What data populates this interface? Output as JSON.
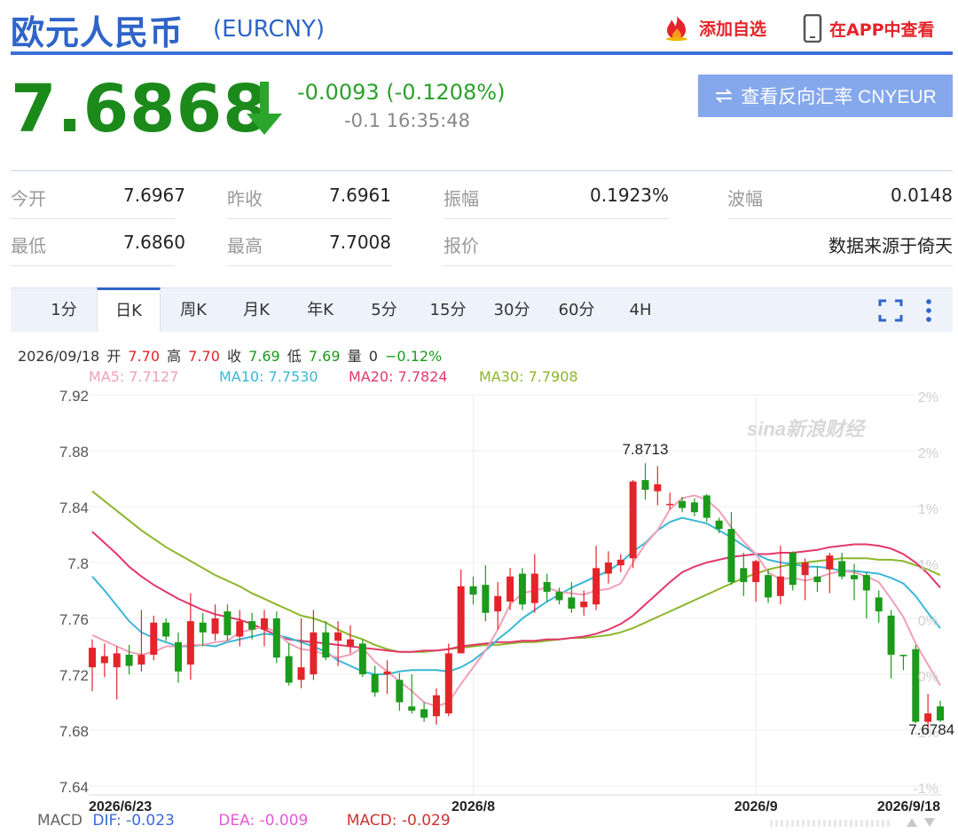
{
  "header": {
    "title": "欧元人民币",
    "code": "(EURCNY)",
    "add_watch": "添加自选",
    "app_view": "在APP中查看"
  },
  "quote": {
    "price": "7.6868",
    "change": "-0.0093 (-0.1208%)",
    "sub": "-0.1 16:35:48",
    "reverse_button": "查看反向汇率 CNYEUR",
    "direction": "down",
    "down_color": "#1b8a1b"
  },
  "stats": [
    {
      "label": "今开",
      "value": "7.6967"
    },
    {
      "label": "昨收",
      "value": "7.6961"
    },
    {
      "label": "振幅",
      "value": "0.1923%"
    },
    {
      "label": "波幅",
      "value": "0.0148"
    },
    {
      "label": "最低",
      "value": "7.6860"
    },
    {
      "label": "最高",
      "value": "7.7008"
    },
    {
      "label": "报价",
      "value": ""
    },
    {
      "label": "",
      "value": "数据来源于倚天"
    }
  ],
  "tabs": [
    "1分",
    "日K",
    "周K",
    "月K",
    "年K",
    "5分",
    "15分",
    "30分",
    "60分",
    "4H"
  ],
  "active_tab": "日K",
  "info": {
    "date": "2026/09/18",
    "open_label": "开",
    "open": "7.70",
    "high_label": "高",
    "high": "7.70",
    "close_label": "收",
    "close": "7.69",
    "low_label": "低",
    "low": "7.69",
    "vol_label": "量",
    "vol": "0",
    "pct": "−0.12%"
  },
  "ma": {
    "ma5": "MA5: 7.7127",
    "ma10": "MA10: 7.7530",
    "ma20": "MA20: 7.7824",
    "ma30": "MA30: 7.7908"
  },
  "macd": {
    "label": "MACD",
    "dif": "DIF: -0.023",
    "dea": "DEA: -0.009",
    "macd": "MACD: -0.029"
  },
  "watermark": "sina新浪财经",
  "chart_data": {
    "type": "candlestick",
    "y_ticks": [
      "7.92",
      "7.88",
      "7.84",
      "7.8",
      "7.76",
      "7.72",
      "7.68",
      "7.64"
    ],
    "ylim": [
      7.64,
      7.92
    ],
    "pct_ticks": [
      "2%",
      "2%",
      "1%",
      "1%",
      "0%",
      "0%",
      "-1%",
      "-1%"
    ],
    "x_ticks": [
      "2026/6/23",
      "2026/8",
      "2026/9",
      "2026/9/18"
    ],
    "x_tick_positions": [
      0,
      31,
      54,
      68
    ],
    "high_label": "7.8713",
    "low_label": "7.6784",
    "colors": {
      "up": "#e4242a",
      "down": "#1b9a1b",
      "ma5": "#f0a0b8",
      "ma10": "#3ab7d6",
      "ma20": "#e3386a",
      "ma30": "#8cb62b"
    },
    "candles": [
      {
        "o": 7.725,
        "c": 7.739,
        "h": 7.745,
        "l": 7.708
      },
      {
        "o": 7.728,
        "c": 7.733,
        "h": 7.742,
        "l": 7.718
      },
      {
        "o": 7.725,
        "c": 7.735,
        "h": 7.74,
        "l": 7.702
      },
      {
        "o": 7.734,
        "c": 7.726,
        "h": 7.741,
        "l": 7.72
      },
      {
        "o": 7.727,
        "c": 7.734,
        "h": 7.766,
        "l": 7.722
      },
      {
        "o": 7.734,
        "c": 7.757,
        "h": 7.762,
        "l": 7.73
      },
      {
        "o": 7.757,
        "c": 7.747,
        "h": 7.76,
        "l": 7.744
      },
      {
        "o": 7.743,
        "c": 7.722,
        "h": 7.75,
        "l": 7.714
      },
      {
        "o": 7.727,
        "c": 7.758,
        "h": 7.778,
        "l": 7.716
      },
      {
        "o": 7.757,
        "c": 7.75,
        "h": 7.764,
        "l": 7.74
      },
      {
        "o": 7.749,
        "c": 7.76,
        "h": 7.77,
        "l": 7.744
      },
      {
        "o": 7.765,
        "c": 7.748,
        "h": 7.77,
        "l": 7.744
      },
      {
        "o": 7.747,
        "c": 7.758,
        "h": 7.766,
        "l": 7.74
      },
      {
        "o": 7.758,
        "c": 7.752,
        "h": 7.764,
        "l": 7.745
      },
      {
        "o": 7.752,
        "c": 7.76,
        "h": 7.766,
        "l": 7.74
      },
      {
        "o": 7.76,
        "c": 7.732,
        "h": 7.765,
        "l": 7.728
      },
      {
        "o": 7.733,
        "c": 7.714,
        "h": 7.742,
        "l": 7.712
      },
      {
        "o": 7.716,
        "c": 7.725,
        "h": 7.76,
        "l": 7.71
      },
      {
        "o": 7.72,
        "c": 7.75,
        "h": 7.766,
        "l": 7.716
      },
      {
        "o": 7.75,
        "c": 7.732,
        "h": 7.758,
        "l": 7.73
      },
      {
        "o": 7.744,
        "c": 7.75,
        "h": 7.758,
        "l": 7.726
      },
      {
        "o": 7.74,
        "c": 7.745,
        "h": 7.755,
        "l": 7.735
      },
      {
        "o": 7.742,
        "c": 7.72,
        "h": 7.745,
        "l": 7.718
      },
      {
        "o": 7.72,
        "c": 7.707,
        "h": 7.726,
        "l": 7.704
      },
      {
        "o": 7.72,
        "c": 7.722,
        "h": 7.73,
        "l": 7.706
      },
      {
        "o": 7.716,
        "c": 7.7,
        "h": 7.721,
        "l": 7.694
      },
      {
        "o": 7.697,
        "c": 7.694,
        "h": 7.72,
        "l": 7.692
      },
      {
        "o": 7.695,
        "c": 7.689,
        "h": 7.7,
        "l": 7.686
      },
      {
        "o": 7.69,
        "c": 7.705,
        "h": 7.71,
        "l": 7.684
      },
      {
        "o": 7.692,
        "c": 7.735,
        "h": 7.742,
        "l": 7.69
      },
      {
        "o": 7.735,
        "c": 7.783,
        "h": 7.795,
        "l": 7.735
      },
      {
        "o": 7.783,
        "c": 7.777,
        "h": 7.79,
        "l": 7.77
      },
      {
        "o": 7.784,
        "c": 7.764,
        "h": 7.798,
        "l": 7.758
      },
      {
        "o": 7.765,
        "c": 7.776,
        "h": 7.786,
        "l": 7.752
      },
      {
        "o": 7.772,
        "c": 7.79,
        "h": 7.796,
        "l": 7.766
      },
      {
        "o": 7.792,
        "c": 7.77,
        "h": 7.796,
        "l": 7.766
      },
      {
        "o": 7.771,
        "c": 7.792,
        "h": 7.806,
        "l": 7.764
      },
      {
        "o": 7.786,
        "c": 7.779,
        "h": 7.792,
        "l": 7.772
      },
      {
        "o": 7.779,
        "c": 7.773,
        "h": 7.782,
        "l": 7.77
      },
      {
        "o": 7.775,
        "c": 7.767,
        "h": 7.786,
        "l": 7.764
      },
      {
        "o": 7.768,
        "c": 7.772,
        "h": 7.78,
        "l": 7.762
      },
      {
        "o": 7.77,
        "c": 7.796,
        "h": 7.812,
        "l": 7.766
      },
      {
        "o": 7.792,
        "c": 7.8,
        "h": 7.808,
        "l": 7.785
      },
      {
        "o": 7.798,
        "c": 7.802,
        "h": 7.806,
        "l": 7.793
      },
      {
        "o": 7.803,
        "c": 7.858,
        "h": 7.859,
        "l": 7.796
      },
      {
        "o": 7.859,
        "c": 7.852,
        "h": 7.871,
        "l": 7.845
      },
      {
        "o": 7.851,
        "c": 7.856,
        "h": 7.869,
        "l": 7.841
      },
      {
        "o": 7.842,
        "c": 7.842,
        "h": 7.85,
        "l": 7.838
      },
      {
        "o": 7.844,
        "c": 7.839,
        "h": 7.847,
        "l": 7.836
      },
      {
        "o": 7.843,
        "c": 7.836,
        "h": 7.846,
        "l": 7.833
      },
      {
        "o": 7.848,
        "c": 7.832,
        "h": 7.849,
        "l": 7.829
      },
      {
        "o": 7.83,
        "c": 7.824,
        "h": 7.832,
        "l": 7.821
      },
      {
        "o": 7.824,
        "c": 7.786,
        "h": 7.836,
        "l": 7.784
      },
      {
        "o": 7.796,
        "c": 7.786,
        "h": 7.807,
        "l": 7.776
      },
      {
        "o": 7.786,
        "c": 7.801,
        "h": 7.802,
        "l": 7.772
      },
      {
        "o": 7.791,
        "c": 7.775,
        "h": 7.795,
        "l": 7.771
      },
      {
        "o": 7.776,
        "c": 7.79,
        "h": 7.812,
        "l": 7.77
      },
      {
        "o": 7.807,
        "c": 7.784,
        "h": 7.808,
        "l": 7.78
      },
      {
        "o": 7.791,
        "c": 7.8,
        "h": 7.803,
        "l": 7.773
      },
      {
        "o": 7.79,
        "c": 7.786,
        "h": 7.797,
        "l": 7.779
      },
      {
        "o": 7.795,
        "c": 7.805,
        "h": 7.807,
        "l": 7.778
      },
      {
        "o": 7.801,
        "c": 7.79,
        "h": 7.807,
        "l": 7.788
      },
      {
        "o": 7.791,
        "c": 7.788,
        "h": 7.799,
        "l": 7.773
      },
      {
        "o": 7.791,
        "c": 7.78,
        "h": 7.793,
        "l": 7.76
      },
      {
        "o": 7.775,
        "c": 7.765,
        "h": 7.78,
        "l": 7.757
      },
      {
        "o": 7.762,
        "c": 7.734,
        "h": 7.766,
        "l": 7.717
      },
      {
        "o": 7.734,
        "c": 7.733,
        "h": 7.734,
        "l": 7.723
      },
      {
        "o": 7.738,
        "c": 7.686,
        "h": 7.741,
        "l": 7.685
      },
      {
        "o": 7.686,
        "c": 7.692,
        "h": 7.706,
        "l": 7.678
      },
      {
        "o": 7.697,
        "c": 7.687,
        "h": 7.701,
        "l": 7.686
      }
    ],
    "ma5": [
      7.748,
      7.744,
      7.74,
      7.736,
      7.734,
      7.736,
      7.74,
      7.74,
      7.741,
      7.741,
      7.743,
      7.744,
      7.75,
      7.752,
      7.754,
      7.75,
      7.742,
      7.738,
      7.737,
      7.734,
      7.732,
      7.734,
      7.739,
      7.729,
      7.722,
      7.715,
      7.708,
      7.7,
      7.697,
      7.7,
      7.713,
      7.725,
      7.737,
      7.752,
      7.77,
      7.778,
      7.78,
      7.782,
      7.779,
      7.778,
      7.777,
      7.78,
      7.781,
      7.785,
      7.8,
      7.813,
      7.823,
      7.838,
      7.846,
      7.848,
      7.845,
      7.837,
      7.825,
      7.815,
      7.806,
      7.793,
      7.788,
      7.789,
      7.787,
      7.789,
      7.792,
      7.794,
      7.793,
      7.79,
      7.786,
      7.774,
      7.761,
      7.742,
      7.727,
      7.712
    ],
    "ma10": [
      7.79,
      7.78,
      7.769,
      7.758,
      7.75,
      7.746,
      7.743,
      7.74,
      7.74,
      7.741,
      7.74,
      7.743,
      7.745,
      7.747,
      7.749,
      7.748,
      7.746,
      7.743,
      7.74,
      7.736,
      7.73,
      7.726,
      7.722,
      7.72,
      7.72,
      7.722,
      7.723,
      7.723,
      7.723,
      7.722,
      7.725,
      7.73,
      7.737,
      7.745,
      7.752,
      7.76,
      7.766,
      7.772,
      7.777,
      7.782,
      7.786,
      7.79,
      7.794,
      7.8,
      7.808,
      7.814,
      7.823,
      7.829,
      7.832,
      7.83,
      7.828,
      7.823,
      7.818,
      7.812,
      7.806,
      7.802,
      7.8,
      7.799,
      7.797,
      7.797,
      7.796,
      7.794,
      7.794,
      7.793,
      7.792,
      7.789,
      7.785,
      7.776,
      7.764,
      7.753
    ],
    "ma20": [
      7.822,
      7.814,
      7.806,
      7.797,
      7.79,
      7.784,
      7.779,
      7.774,
      7.77,
      7.766,
      7.763,
      7.761,
      7.759,
      7.756,
      7.752,
      7.748,
      7.745,
      7.744,
      7.743,
      7.742,
      7.741,
      7.74,
      7.739,
      7.738,
      7.737,
      7.736,
      7.736,
      7.737,
      7.737,
      7.738,
      7.74,
      7.741,
      7.742,
      7.743,
      7.743,
      7.744,
      7.744,
      7.745,
      7.745,
      7.746,
      7.747,
      7.749,
      7.752,
      7.756,
      7.762,
      7.77,
      7.778,
      7.786,
      7.793,
      7.797,
      7.8,
      7.802,
      7.804,
      7.805,
      7.806,
      7.806,
      7.807,
      7.807,
      7.808,
      7.809,
      7.811,
      7.812,
      7.813,
      7.813,
      7.812,
      7.81,
      7.806,
      7.8,
      7.792,
      7.782
    ],
    "ma30": [
      7.851,
      7.844,
      7.837,
      7.83,
      7.823,
      7.817,
      7.811,
      7.806,
      7.801,
      7.796,
      7.791,
      7.787,
      7.783,
      7.778,
      7.774,
      7.77,
      7.766,
      7.762,
      7.76,
      7.757,
      7.752,
      7.748,
      7.745,
      7.741,
      7.738,
      7.736,
      7.736,
      7.736,
      7.737,
      7.738,
      7.739,
      7.74,
      7.741,
      7.741,
      7.742,
      7.743,
      7.743,
      7.744,
      7.745,
      7.746,
      7.746,
      7.747,
      7.748,
      7.75,
      7.753,
      7.757,
      7.761,
      7.765,
      7.769,
      7.773,
      7.777,
      7.781,
      7.785,
      7.789,
      7.792,
      7.795,
      7.797,
      7.799,
      7.8,
      7.801,
      7.802,
      7.803,
      7.803,
      7.803,
      7.802,
      7.802,
      7.801,
      7.798,
      7.795,
      7.791
    ]
  }
}
